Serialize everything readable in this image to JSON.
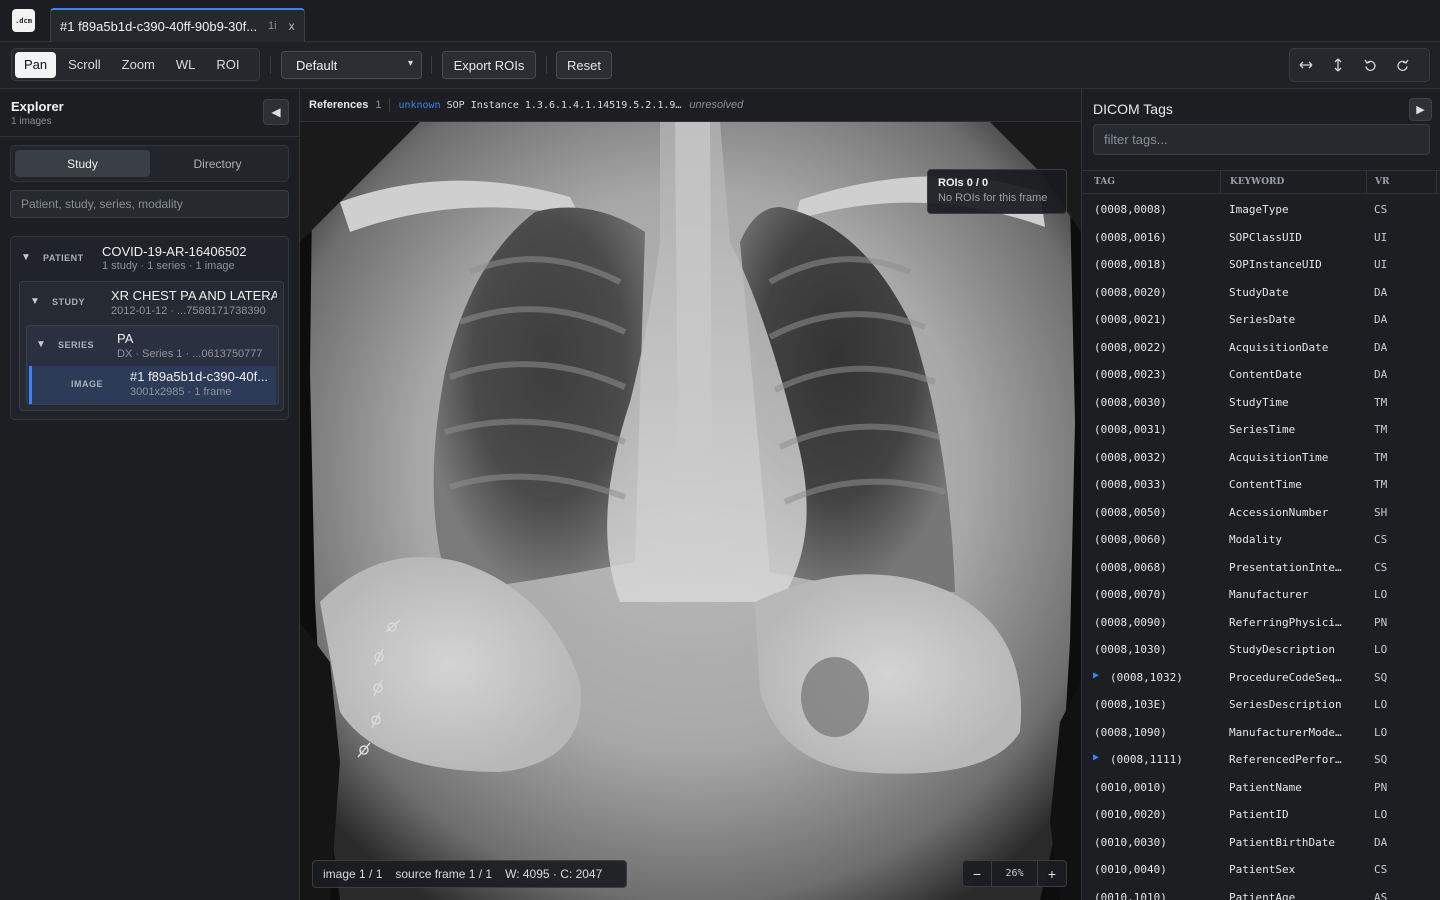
{
  "app": {
    "logo_text": ".dcm"
  },
  "tab": {
    "title": "#1 f89a5b1d-c390-40ff-90b9-30f...",
    "count": "1i",
    "close": "x"
  },
  "toolbar": {
    "tools": [
      "Pan",
      "Scroll",
      "Zoom",
      "WL",
      "ROI"
    ],
    "active_tool": "Pan",
    "preset": "Default",
    "export_label": "Export ROIs",
    "reset_label": "Reset",
    "icons": [
      "flip-horizontal-icon",
      "flip-vertical-icon",
      "rotate-left-icon",
      "rotate-right-icon"
    ]
  },
  "explorer": {
    "title": "Explorer",
    "subtitle": "1 images",
    "tabs": [
      "Study",
      "Directory"
    ],
    "active_tab": "Study",
    "search_placeholder": "Patient, study, series, modality",
    "patient": {
      "kind": "PATIENT",
      "name": "COVID-19-AR-16406502",
      "meta": "1 study · 1 series · 1 image"
    },
    "study": {
      "kind": "STUDY",
      "name": "XR CHEST PA AND LATERAL",
      "meta": "2012-01-12 · ...7588171738390"
    },
    "series": {
      "kind": "SERIES",
      "name": "PA",
      "meta": "DX · Series 1 · ...0613750777"
    },
    "image": {
      "kind": "IMAGE",
      "name": "#1 f89a5b1d-c390-40f...",
      "meta": "3001x2985 · 1 frame"
    }
  },
  "viewer": {
    "refs_label": "References",
    "refs_count": "1",
    "ref_tag": "unknown",
    "ref_text": "SOP Instance 1.3.6.1.4.1.14519.5.2.1.9…",
    "ref_status": "unresolved",
    "roi_title": "ROIs 0 / 0",
    "roi_sub": "No ROIs for this frame",
    "status_image": "image 1 / 1",
    "status_frame": "source frame 1 / 1",
    "status_wl": "W: 4095 · C: 2047",
    "zoom_minus": "−",
    "zoom_value": "26%",
    "zoom_plus": "+"
  },
  "tags": {
    "title": "DICOM Tags",
    "filter_placeholder": "filter tags...",
    "columns": [
      "TAG",
      "KEYWORD",
      "VR"
    ],
    "rows": [
      {
        "tag": "(0008,0008)",
        "keyword": "ImageType",
        "vr": "CS",
        "seq": false
      },
      {
        "tag": "(0008,0016)",
        "keyword": "SOPClassUID",
        "vr": "UI",
        "seq": false
      },
      {
        "tag": "(0008,0018)",
        "keyword": "SOPInstanceUID",
        "vr": "UI",
        "seq": false
      },
      {
        "tag": "(0008,0020)",
        "keyword": "StudyDate",
        "vr": "DA",
        "seq": false
      },
      {
        "tag": "(0008,0021)",
        "keyword": "SeriesDate",
        "vr": "DA",
        "seq": false
      },
      {
        "tag": "(0008,0022)",
        "keyword": "AcquisitionDate",
        "vr": "DA",
        "seq": false
      },
      {
        "tag": "(0008,0023)",
        "keyword": "ContentDate",
        "vr": "DA",
        "seq": false
      },
      {
        "tag": "(0008,0030)",
        "keyword": "StudyTime",
        "vr": "TM",
        "seq": false
      },
      {
        "tag": "(0008,0031)",
        "keyword": "SeriesTime",
        "vr": "TM",
        "seq": false
      },
      {
        "tag": "(0008,0032)",
        "keyword": "AcquisitionTime",
        "vr": "TM",
        "seq": false
      },
      {
        "tag": "(0008,0033)",
        "keyword": "ContentTime",
        "vr": "TM",
        "seq": false
      },
      {
        "tag": "(0008,0050)",
        "keyword": "AccessionNumber",
        "vr": "SH",
        "seq": false
      },
      {
        "tag": "(0008,0060)",
        "keyword": "Modality",
        "vr": "CS",
        "seq": false
      },
      {
        "tag": "(0008,0068)",
        "keyword": "PresentationInte…",
        "vr": "CS",
        "seq": false
      },
      {
        "tag": "(0008,0070)",
        "keyword": "Manufacturer",
        "vr": "LO",
        "seq": false
      },
      {
        "tag": "(0008,0090)",
        "keyword": "ReferringPhysici…",
        "vr": "PN",
        "seq": false
      },
      {
        "tag": "(0008,1030)",
        "keyword": "StudyDescription",
        "vr": "LO",
        "seq": false
      },
      {
        "tag": "(0008,1032)",
        "keyword": "ProcedureCodeSeq…",
        "vr": "SQ",
        "seq": true
      },
      {
        "tag": "(0008,103E)",
        "keyword": "SeriesDescription",
        "vr": "LO",
        "seq": false
      },
      {
        "tag": "(0008,1090)",
        "keyword": "ManufacturerMode…",
        "vr": "LO",
        "seq": false
      },
      {
        "tag": "(0008,1111)",
        "keyword": "ReferencedPerfor…",
        "vr": "SQ",
        "seq": true
      },
      {
        "tag": "(0010,0010)",
        "keyword": "PatientName",
        "vr": "PN",
        "seq": false
      },
      {
        "tag": "(0010,0020)",
        "keyword": "PatientID",
        "vr": "LO",
        "seq": false
      },
      {
        "tag": "(0010,0030)",
        "keyword": "PatientBirthDate",
        "vr": "DA",
        "seq": false
      },
      {
        "tag": "(0010,0040)",
        "keyword": "PatientSex",
        "vr": "CS",
        "seq": false
      },
      {
        "tag": "(0010,1010)",
        "keyword": "PatientAge",
        "vr": "AS",
        "seq": false
      }
    ]
  }
}
